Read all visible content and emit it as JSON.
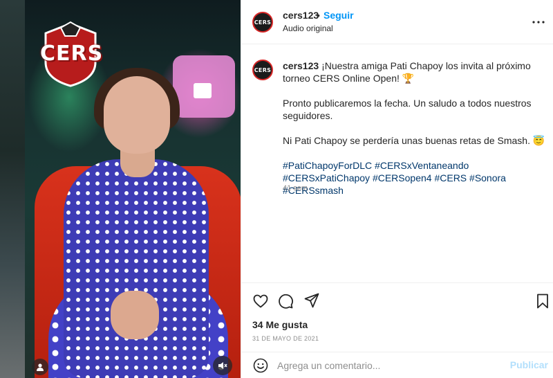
{
  "post": {
    "username": "cers123",
    "avatar_text": "CERS",
    "separator": "•",
    "follow_label": "Seguir",
    "audio_label": "Audio original",
    "caption": {
      "username": "cers123",
      "para1": "¡Nuestra amiga Pati Chapoy los invita al próximo torneo CERS Online Open! 🏆",
      "para2": "Pronto publicaremos la fecha. Un saludo a todos nuestros seguidores.",
      "para3": "Ni Pati Chapoy se perdería unas buenas retas de Smash. 😇",
      "hashtags": "#PatiChapoyForDLC #CERSxVentaneando #CERSxPatiChapoy #CERSopen4 #CERS #Sonora #CERSsmash"
    },
    "time_ago": "41 sem",
    "likes": "34 Me gusta",
    "date": "31 DE MAYO DE 2021"
  },
  "media": {
    "logo_text": "CERS"
  },
  "comment_box": {
    "placeholder": "Agrega un comentario...",
    "post_label": "Publicar"
  },
  "icons": {
    "more": "more-options-icon",
    "like": "heart-icon",
    "comment": "comment-icon",
    "share": "share-icon",
    "save": "bookmark-icon",
    "emoji": "emoji-icon",
    "tagged_user": "user-icon",
    "mute": "speaker-muted-icon"
  },
  "colors": {
    "accent": "#0095f6",
    "hashtag": "#00376b",
    "muted_text": "#8e8e8e",
    "post_disabled": "#b2dffc"
  }
}
